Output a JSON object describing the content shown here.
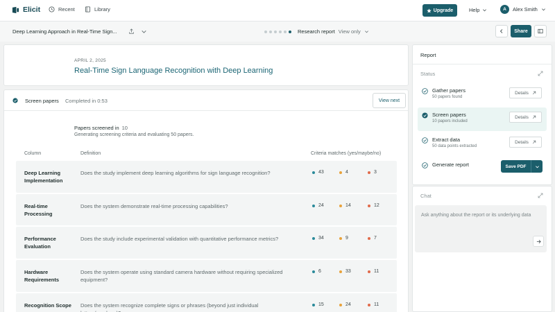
{
  "nav": {
    "brand": "Elicit",
    "recent": "Recent",
    "library": "Library",
    "upgrade": "Upgrade",
    "help": "Help",
    "user_initial": "A",
    "user_name": "Alex Smith"
  },
  "subheader": {
    "doc_title": "Deep Learning Approach in Real-Time Sign...",
    "report_label": "Research report",
    "view_mode": "View only",
    "share": "Share",
    "progress_dots_total": 6,
    "progress_dots_active": 6
  },
  "doc": {
    "date": "APRIL 2, 2025",
    "title": "Real-Time Sign Language Recognition with Deep Learning"
  },
  "screen": {
    "label": "Screen papers",
    "time": "Completed in 0:53",
    "view_next": "View next",
    "papers_screened_label": "Papers screened in",
    "papers_screened_count": "10",
    "description": "Generating screening criteria and evaluating 50 papers."
  },
  "table": {
    "headers": [
      "Column",
      "Definition",
      "Criteria matches (yes/maybe/no)"
    ],
    "rows": [
      {
        "name": "Deep Learning Implementation",
        "definition": "Does the study implement deep learning algorithms for sign language recognition?",
        "yes": "43",
        "maybe": "4",
        "no": "3"
      },
      {
        "name": "Real-time Processing",
        "definition": "Does the system demonstrate real-time processing capabilities?",
        "yes": "24",
        "maybe": "14",
        "no": "12"
      },
      {
        "name": "Performance Evaluation",
        "definition": "Does the study include experimental validation with quantitative performance metrics?",
        "yes": "34",
        "maybe": "9",
        "no": "7"
      },
      {
        "name": "Hardware Requirements",
        "definition": "Does the system operate using standard camera hardware without requiring specialized equipment?",
        "yes": "6",
        "maybe": "33",
        "no": "11"
      },
      {
        "name": "Recognition Scope",
        "definition": "Does the system recognize complete signs or phrases (beyond just individual letters/numbers)?",
        "yes": "15",
        "maybe": "24",
        "no": "11"
      }
    ]
  },
  "report": {
    "title": "Report",
    "status_label": "Status",
    "steps": [
      {
        "name": "Gather papers",
        "sub": "50 papers found",
        "action": "Details"
      },
      {
        "name": "Screen papers",
        "sub": "10 papers included",
        "action": "Details"
      },
      {
        "name": "Extract data",
        "sub": "50 data points extracted",
        "action": "Details"
      },
      {
        "name": "Generate report",
        "sub": "",
        "action": "Save PDF"
      }
    ]
  },
  "chat": {
    "title": "Chat",
    "placeholder": "Ask anything about the report or its underlying data"
  },
  "colors": {
    "accent": "#1b5e6b",
    "title_teal": "#1b6574",
    "yes": "#2a8a9a",
    "maybe": "#e8a23a",
    "no": "#e06a4a",
    "active_step_bg": "#eaf5f3"
  }
}
